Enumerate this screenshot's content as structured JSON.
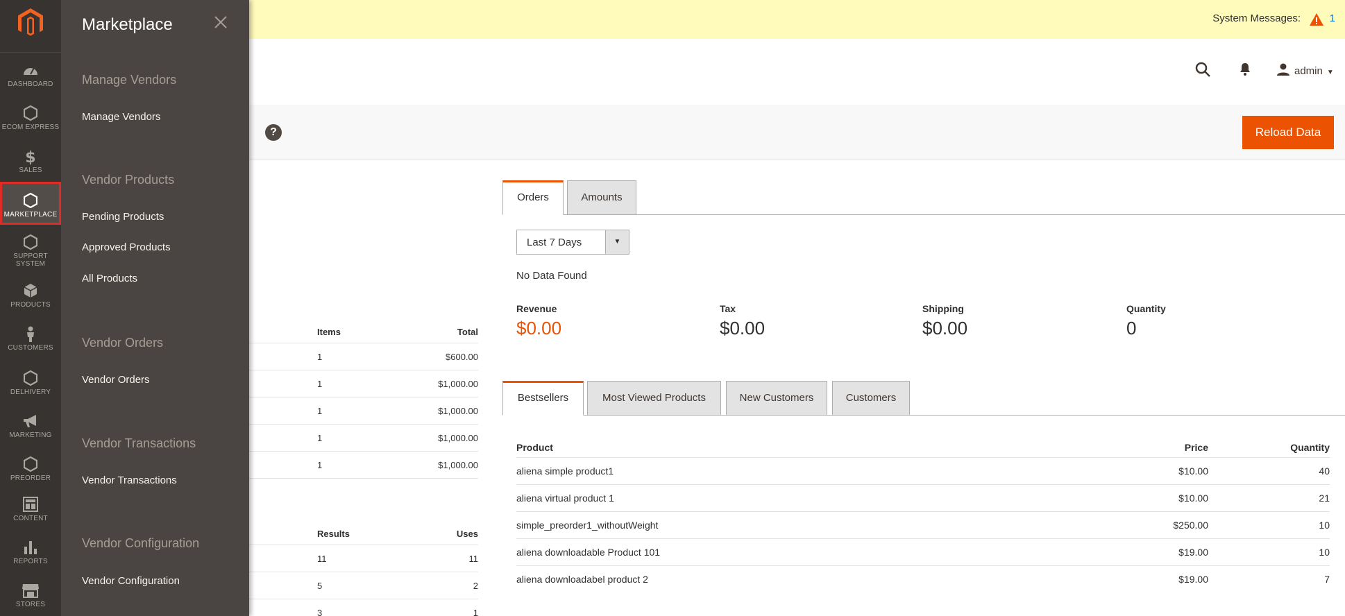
{
  "admin_nav": {
    "items": [
      {
        "label": "DASHBOARD",
        "icon": "dashboard-icon"
      },
      {
        "label": "ECOM EXPRESS",
        "icon": "hexagon-icon"
      },
      {
        "label": "SALES",
        "icon": "dollar-icon"
      },
      {
        "label": "MARKETPLACE",
        "icon": "hexagon-icon"
      },
      {
        "label": "SUPPORT",
        "label2": "SYSTEM",
        "icon": "hexagon-icon"
      },
      {
        "label": "PRODUCTS",
        "icon": "box-icon"
      },
      {
        "label": "CUSTOMERS",
        "icon": "person-icon"
      },
      {
        "label": "DELHIVERY",
        "icon": "hexagon-icon"
      },
      {
        "label": "MARKETING",
        "icon": "megaphone-icon"
      },
      {
        "label": "PREORDER",
        "icon": "hexagon-icon"
      },
      {
        "label": "CONTENT",
        "icon": "layout-icon"
      },
      {
        "label": "REPORTS",
        "icon": "bar-chart-icon"
      },
      {
        "label": "STORES",
        "icon": "store-icon"
      }
    ]
  },
  "flyout": {
    "title": "Marketplace",
    "groups": [
      {
        "title": "Manage Vendors",
        "links": [
          "Manage Vendors"
        ]
      },
      {
        "title": "Vendor Products",
        "links": [
          "Pending Products",
          "Approved Products",
          "All Products"
        ]
      },
      {
        "title": "Vendor Orders",
        "links": [
          "Vendor Orders"
        ]
      },
      {
        "title": "Vendor Transactions",
        "links": [
          "Vendor Transactions"
        ]
      },
      {
        "title": "Vendor Configuration",
        "links": [
          "Vendor Configuration"
        ]
      }
    ]
  },
  "system_messages": {
    "label": "System Messages:",
    "count": "1"
  },
  "header": {
    "user": "admin"
  },
  "actions": {
    "help": "?",
    "reload_label": "Reload Data"
  },
  "last_orders": {
    "headers": {
      "items": "Items",
      "total": "Total"
    },
    "rows": [
      {
        "items": "1",
        "total": "$600.00"
      },
      {
        "items": "1",
        "total": "$1,000.00"
      },
      {
        "items": "1",
        "total": "$1,000.00"
      },
      {
        "items": "1",
        "total": "$1,000.00"
      },
      {
        "items": "1",
        "total": "$1,000.00"
      }
    ]
  },
  "last_search": {
    "headers": {
      "results": "Results",
      "uses": "Uses"
    },
    "rows": [
      {
        "results": "11",
        "uses": "11"
      },
      {
        "results": "5",
        "uses": "2"
      },
      {
        "results": "3",
        "uses": "1"
      }
    ]
  },
  "chart_tabs": [
    "Orders",
    "Amounts"
  ],
  "period": {
    "selected": "Last 7 Days"
  },
  "no_data": "No Data Found",
  "totals": [
    {
      "label": "Revenue",
      "value": "$0.00"
    },
    {
      "label": "Tax",
      "value": "$0.00"
    },
    {
      "label": "Shipping",
      "value": "$0.00"
    },
    {
      "label": "Quantity",
      "value": "0"
    }
  ],
  "grid_tabs": [
    "Bestsellers",
    "Most Viewed Products",
    "New Customers",
    "Customers"
  ],
  "bestsellers": {
    "headers": {
      "product": "Product",
      "price": "Price",
      "quantity": "Quantity"
    },
    "rows": [
      {
        "product": "aliena simple product1",
        "price": "$10.00",
        "quantity": "40"
      },
      {
        "product": "aliena virtual product 1",
        "price": "$10.00",
        "quantity": "21"
      },
      {
        "product": "simple_preorder1_withoutWeight",
        "price": "$250.00",
        "quantity": "10"
      },
      {
        "product": "aliena downloadable Product 101",
        "price": "$19.00",
        "quantity": "10"
      },
      {
        "product": "aliena downloadabel product 2",
        "price": "$19.00",
        "quantity": "7"
      }
    ]
  },
  "colors": {
    "accent": "#eb5202",
    "nav_bg": "#373330",
    "flyout_bg": "#4a4542",
    "active_outline": "#e02b27"
  }
}
